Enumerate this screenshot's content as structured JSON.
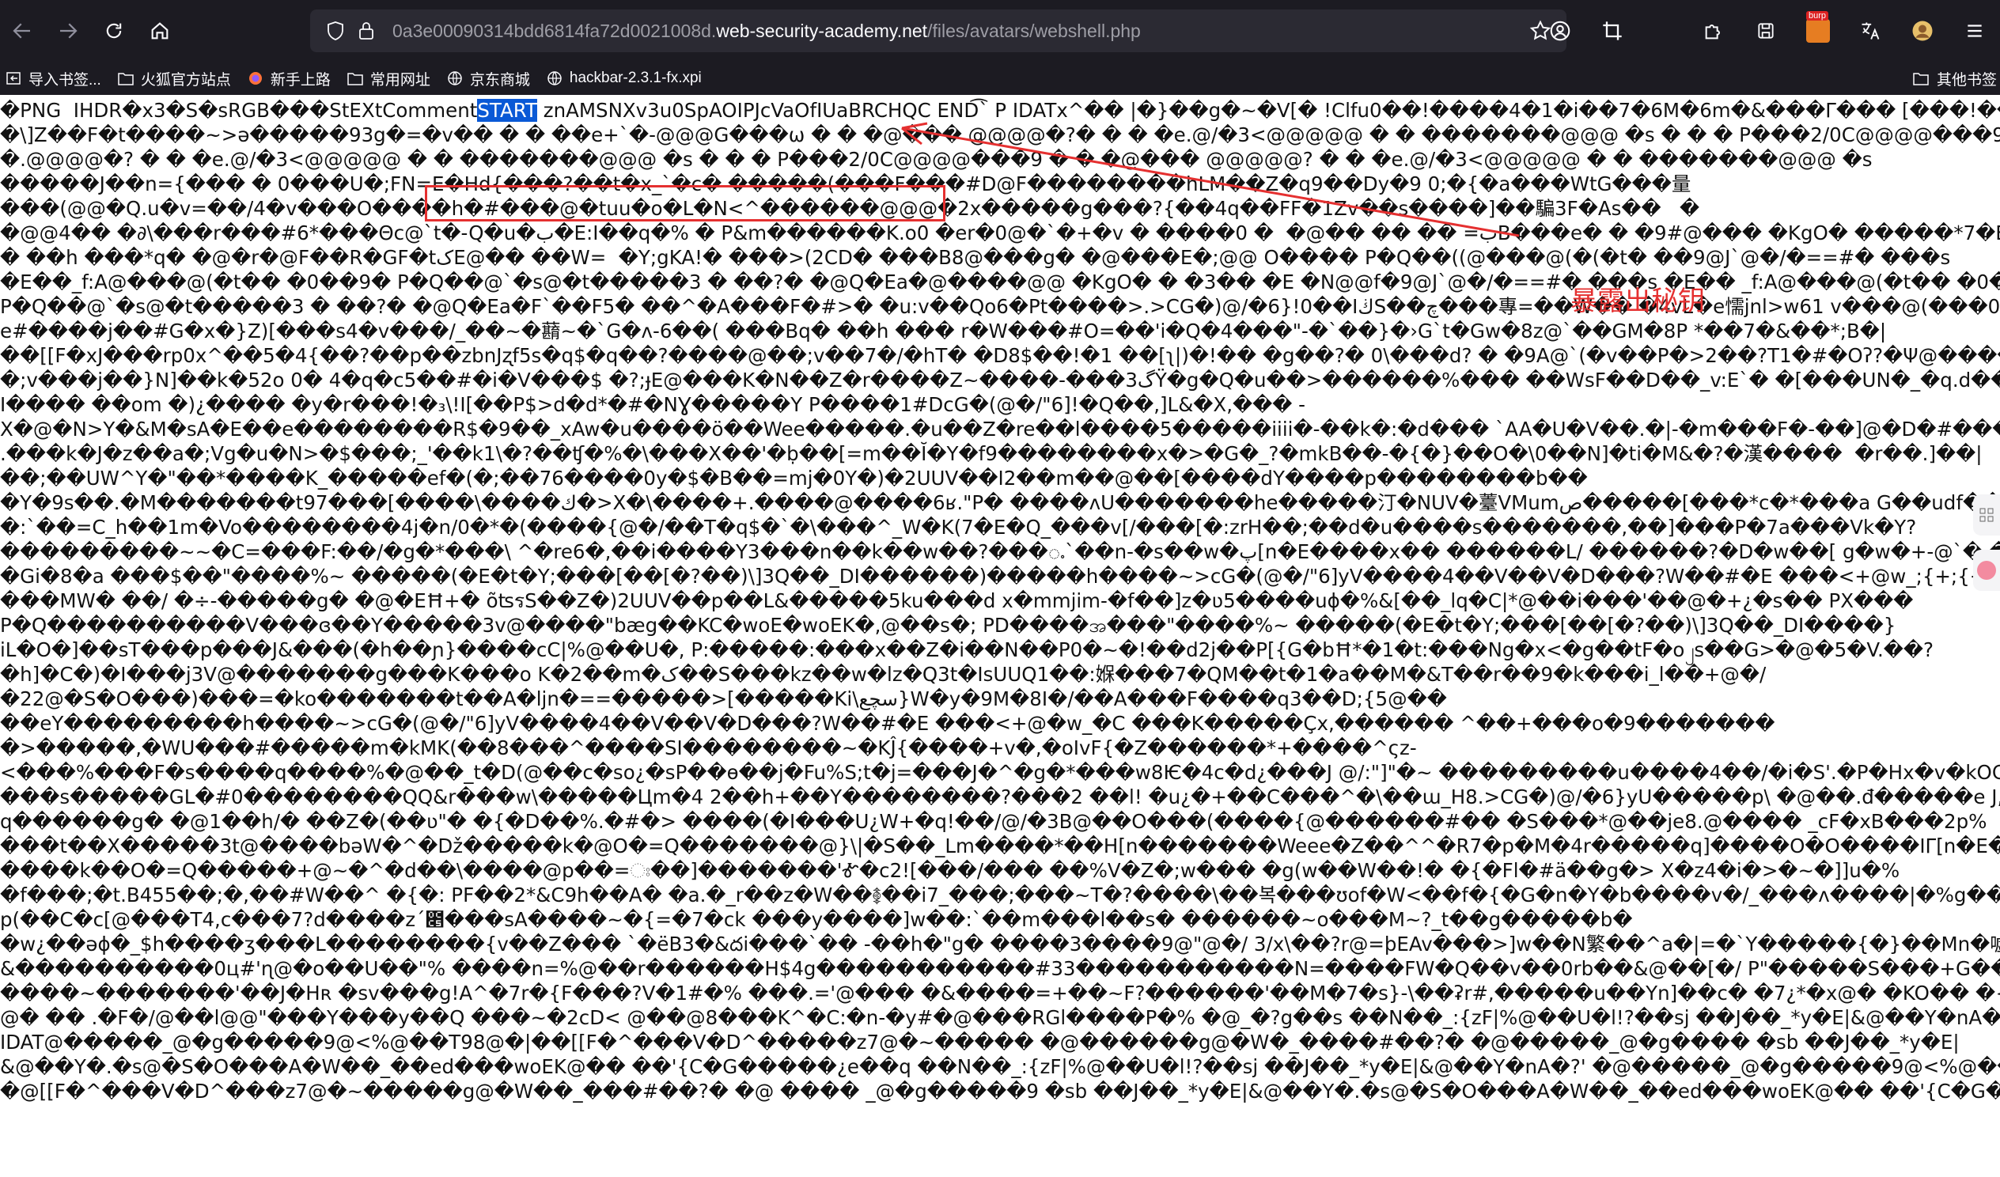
{
  "browser": {
    "url_prefix": "0a3e00090314bdd6814fa72d0021008d.",
    "url_host": "web-security-academy.net",
    "url_path": "/files/avatars/webshell.php",
    "badge_text": "burp"
  },
  "bookmarks": {
    "items": [
      {
        "label": "导入书签..."
      },
      {
        "label": "火狐官方站点"
      },
      {
        "label": "新手上路"
      },
      {
        "label": "常用网址"
      },
      {
        "label": "京东商城"
      },
      {
        "label": "hackbar-2.3.1-fx.xpi"
      }
    ],
    "other_label": "其他书签"
  },
  "page": {
    "first_line_before": "�PNG  IHDR�x3�S�sRGB���StEXtComment",
    "highlight_text": "START",
    "first_line_after": " znAMSNXv3u0SpAOIPJcVaOfIUaBRCHQC END͡` P IDATx^�� |�}��g�~�V[� !Clfu0��!����4�1�i��7�6M�6m�&���Γ��� [���!������ت�]�}�",
    "secret": "znAMSNXv3u0SpAOIPJcVaOfIUaBRCHQC",
    "lines": [
      "�\\]Z��F�t����~>ə�����93g�=�v�� � � ��e+`�-@@@G���ω � � �@��� @@@@�?� � � �e.@/�3<@@@@@ � � �������@@@ �s � � � P���2/0C@@@@���9� � � �@@@��",
      "�.@@@@�? � � �e.@/�3<@@@@@ � � �������@@@ �s � � � P���2/0C@@@@���9 � � �@��� @@@@@? � � �e.@/�3<@@@@@ � � �������@@@ �s",
      "�����J��n={��� � 0���U�;FN=E�Hd{���?��t�x_`�c� �����(���F���#D@F��������hLM��Z�q9��Dy�9 0;�{�a���WtG���量",
      "���(@@�Q.u�v=��/4�v���O����h�#���@�tuu�o�L�N<^������@@@�2x�����g���?{��4q��FF�1Zv��s����]��騙3F�As��   �",
      "�@@4�� �∂\\���r���#6*���Θc@`t�-Q�u�ب�E:I��q�% � P&m������K.o0 �er�0@�`�+�v � ����0 �  �@�� �� �� =بB���e� � �9#@��� �KgO� �����*7�E@� �=V(W��V�q!",
      "� ��h ���*q� �@�r�@F��R�GF�tکE@�� ��W=  �Y;gKA!� ���>(2CD� ���B8@���g� �@���E�;@@ O���� P�Q��((@���@(�(�t� ��9@J`@�/�==#� ���s",
      "�E��_f:A@���@(�t�� �0��9� P�Q��@`�s@�t�����3 � ��?� �@Q�Ea�@����@@ �KgO� � �3�� �E �N@@f�9@J`@�/�==#� ���s �E�� _f:A@���@(�t�� �0��9�",
      "P�Q��@`�s@�t�����3 � ��?� �@Q�Ea�F`��F5� ��^�A���F�#>� �u:v��Qo6�Pt����>.>CG�)@/�6}!0��IڬS��چ���專=��W�� �4vL�e懦jnl>w61 v���@(���0",
      "e#����j��#G�x�}Z)[���s4�v���/_��~�蘛~�`G�ʌ-6��( ���Bq� ��h ��� r�W���#O=��'i�Q�4���\"-�`��}�›G`t�Gw�8z@`��GM�8P *��7�&��*;B�|",
      "��[[F�xJ���rp0x^��5�4{��?��p��zbnJʐf5s�q$�q��?����@��;v��7�/�hT� �D8$��!�1 ��[ʅ|)�!�� �g��?� 0\\���d? � �9A@`(�v��P�>2��?T1�#�Oʔ?�Ψ@����NN��j�r",
      "�;v���j��}N]��k�52o 0� 4�q�c5��#�i�V���$ �?;ɟE@���K�N��Z�r����Z~����-���گ3Ÿ�g�Q�u��>������%��� ��WsF��D��_v:E`� �[���UN�_�q.d������E梱���?",
      "I���� ��om �)¿���� �y�r���!�₃\\!I[��P$>d�d*�#�NƔ�����Y P����1#DcG�(@�/\"6]!�Q��,]L&�X,��� -",
      "X�@�N>Y�&M�sA�E��e��������R$�9��_xAw�u����ö��Wee�����.�u��Z�re��l����5�����iiii�-��k�:�d��� `AA�U�V��.�|-�m���F�-��]@�D�#����@�]��_�f|",
      ".���k�J�z��a�;Vg�u�N>�$���;_'��k1\\�?��ʧ�%�\\���X��'�ḅ��[=m��Ĭ�Y�f9��������x�>�G�_?�mkB��-�{�}��O�\\0��N]�ti�M&�?�漢����  �r��.]��|",
      "��;��UW^Y�\"��*����K_�����ef�(�;��76����0y�$�B��=mj�0Y�)�2UUV��I2��m��@��[����dY����p��������b��",
      "�Y�9s��.�M�������tك����\\����]���97�>X�\\����+.����@����6ʁ.\"P� ����ʌU�������he�����汀�NUV�薹VMumص�����[���*c�*���a G��udf���",
      "�:`��=C_h��1m�Vo��������4j�n/0�*�(����{@�/��T�q$�`�\\���^_W�K(7�E�Q_���v[/���[�:zrH��;��d�u����s�������,��]���P�7a���Vk�Y?",
      "���������~~�C=���F:��/�g�*���\\ ^�re6�,��i����Y3���n��k��w��?���ႉ`��n-�s��w�پ[n�E����x�� ������L/ ������?�D�w��[ g�w�+-@`� �G[�8^@`�",
      "�Gi�8�a ���$��\"����%~ �����(�E�t�Y;���[��[�?��)\\]3Q��_DI������)�����h����~>cG�(@�/\"6]yV����4��V��V�D���?W��#�E ���<+@w_;{+;{+Z\"�g¿����@�",
      "���MW� ��/ �÷-�����g� �@�EĦ+� õʦรS��Z�)2UUV��p��L&�����5ku���d x�mmjim-�f��]z�ʋ5����uɸ�%&[��_lq�C|*@��i���'��@�+¿�s�� PX���",
      "P�Q����������V���ɞ��Y�����3v@����\"bæg��KC�woE�woEK�,@��s�; PD����အ���\"����%~ �����(�E�t�Y;���[��[�?��)\\]3Q��_DI����}",
      "iL�O�]��sT���p���J&���(�h��ɲ}����cC|%@��U�, P:�����:���x��Z�i��N��P0�~�!��d2j��P[{G�bĦ*�1�t:���Ng�x<�g��tF�o၂s��G>�@�5�V.��?",
      "�h]�C�)�I���j3V@�������g���K���o K�2��m�ک��S���kz��w�lz�Q3t�IsUUQ1��:媬���7�QM��t�1�a��M�&T��r��9�k���i_l��+@�/",
      "�22@�S�O���)���=�ko�������t��A�ljn�==�����>[�����Ki\\سچع}W�y�9M�8I�/��A���F����q3��D;{5@��",
      "��eY���������h����~>cG�(@�/\"6]yV����4��V��V�D���?W��#�E ���<+@�w_�C ���K�����Çx,������ ^��+���o�9�������",
      "�>�����,�WU���#�����m�kMK(��8���^����SI��������~�KĴ{����+v�,�oIvF{�Z������*+����^ςz-",
      "<���%���F�s����q����%�@��_t�D(@��c�so¿�sP��ө��j�Fu%S;t�j=���J�^�g�*���w8Ѥ�4c�d¿���J @/:\"]\"�~ ���������u����4��/�i�S'.�P�Hx�v�kOC�+}",
      "���s�����GL�#0��������QQ&r���w\\�����Цm�4 2��h+��Y��������?���2 ��l! �u¿�+��C���^�\\��ɯ_H8.>CG�)@/�6}yU�����p\\ �@��.đ�����e J,@@/",
      "q������g� �@1��h/� ��Z�(��ʋ\"� �{�D��%.�#�> ����(�I���U¿W+�q!��/@/�3B@��O���(����{@������#�� �S���*@��je8.@���� _cF�xB���2p%",
      "���t��X�����3t@����bəW�^�Dž�����k�@O�=Q�������@}\\|�S��_Lm����*��H[n�������Weee�Z��^^�R7�p�M�4r�����q]����O�O����IΓ[n�E��v���кk�Q$)@��",
      "����k��O�=Q�����+@~�^�d��\\����@p��=ඃ��]�������'Ꮉ�c2![���/��� ��%V�Z�;w��� �g(w��W��!� �{�Fl�#ä��g�> X�z4�i�>�~�]]u�%",
      "�f���;�t.B455��;�,��#W��^ �{�: PF��2*&C9h��A� �a.�_r��z�W��࿅��i7_���;���~T�?����\\��복���ʊof�W<��f�{�G�n�Y�b����v�/_���ʌ����|�%g��_v-c�",
      "p(��C�c[@���T4,c���7?d����zˊ೅���sA����~�{=�7�ck ���y����]w��:`��m���l��s� ������~o���M~?_t��g�����b�",
      "�w¿��əɸ�_$h����ʒ���L��������{v��Z��� `�ëB3�&దi���`�� -��h�\"g� ����3����9@\"@�/ 3/x\\��?r@=þEAv���>]w��N繁��^a�|=�`Y�����{�}��Mn�嘘���C~n?",
      "&����������0ц#'ɳ@�o��U��\"% ����n=%@��r������H$4g�����������#33�����������N=����FW�Q��v��0rb��&@��[�/ P\"�����S���+G���=+��sʂ¿��/",
      "����~�������'��J�Hʀ �sv���g!A^�7r�{F���?V�1#�% ���.='@��� �&����=+��~F?������'��M�7�s}-\\��ʡr#,�����u��Yn]��c� �7¿*�x@� �KO�� �{�}0���+�p�A�",
      "@� �� .�F�/@��l@@\"���Y���y��Q ���~�2cD< @��@8���K^�C:�n-�y#�@���RGl����P�% �@_�?g��s ��N��_:{zF|%@��U�l!?��sj ��J��_*y�E|&@��Y�nA�?' ��_��",
      "IDAT@�����_@�g�����9@<%@��T98@�|��[[F�^���V�D^�����z7@�~����� �@������g@�W�_����#��?� �@�����_@�g���� �sb ��J��_*y�E|",
      "&@��Y�.�s@�S�O���A�W��_��ed���woEK@�� ��'{C�G�����¿e��q ��N��_:{zF|%@��U�l!?��sj ��J��_*y�E|&@��Y�nA�?' �@�����_@�g�����9@<%@��T98@�|",
      "�@[[F�^���V�D^���z7@�~�����g@�W��_���#��?� �@ ���� _@�g�����9 �sb ��J��_*y�E|&@��Y�.�s@�S�O���A�W��_��ed���woEK@�� ��'{C�G���� ��e��"
    ]
  },
  "annotation": {
    "label": "暴露出秘钥",
    "color": "#e53030"
  }
}
